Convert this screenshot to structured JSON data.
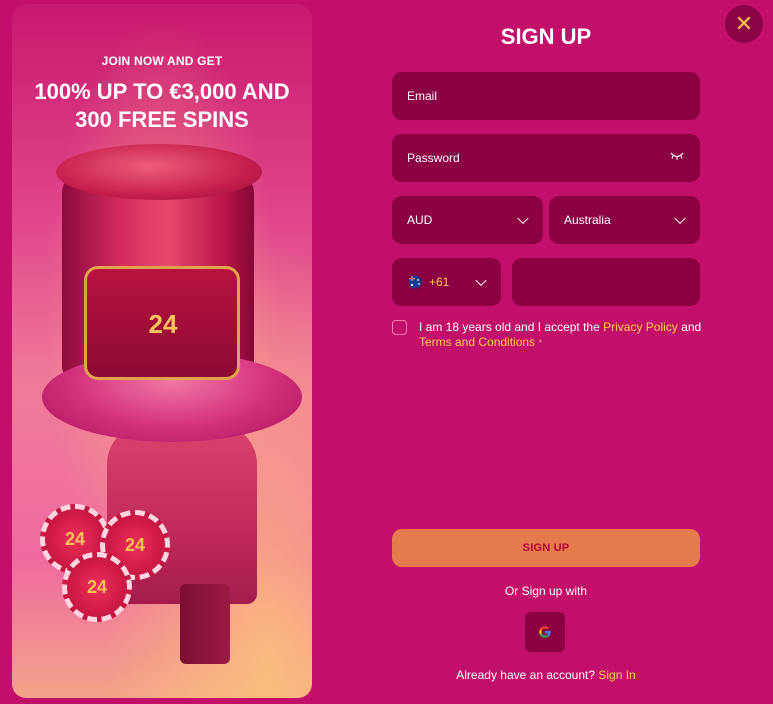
{
  "promo": {
    "subtitle": "JOIN NOW AND GET",
    "headline": "100% UP TO €3,000 AND 300 FREE SPINS",
    "hat_logo": "24",
    "chip_labels": [
      "24",
      "24",
      "24"
    ]
  },
  "close": {
    "icon": "close-icon",
    "glyph": "✕",
    "color": "#f5c54a"
  },
  "form": {
    "title": "SIGN UP",
    "email_placeholder": "Email",
    "password_placeholder": "Password",
    "currency": "AUD",
    "country": "Australia",
    "phone_code": "+61",
    "phone_value": "",
    "consent_prefix": "I am 18 years old and I accept the",
    "privacy_link": "Privacy Policy",
    "and_text": "and",
    "terms_link": "Terms and Conditions",
    "required_mark": "*",
    "submit_label": "SIGN UP",
    "or_text": "Or Sign up with",
    "google_icon": "google-icon",
    "have_account": "Already have an account?",
    "sign_in_link": "Sign In"
  },
  "colors": {
    "background": "#c10f6a",
    "field": "#8c0043",
    "accent_link": "#ffd04a",
    "button": "#e57a4d",
    "button_text": "#b3003f"
  }
}
